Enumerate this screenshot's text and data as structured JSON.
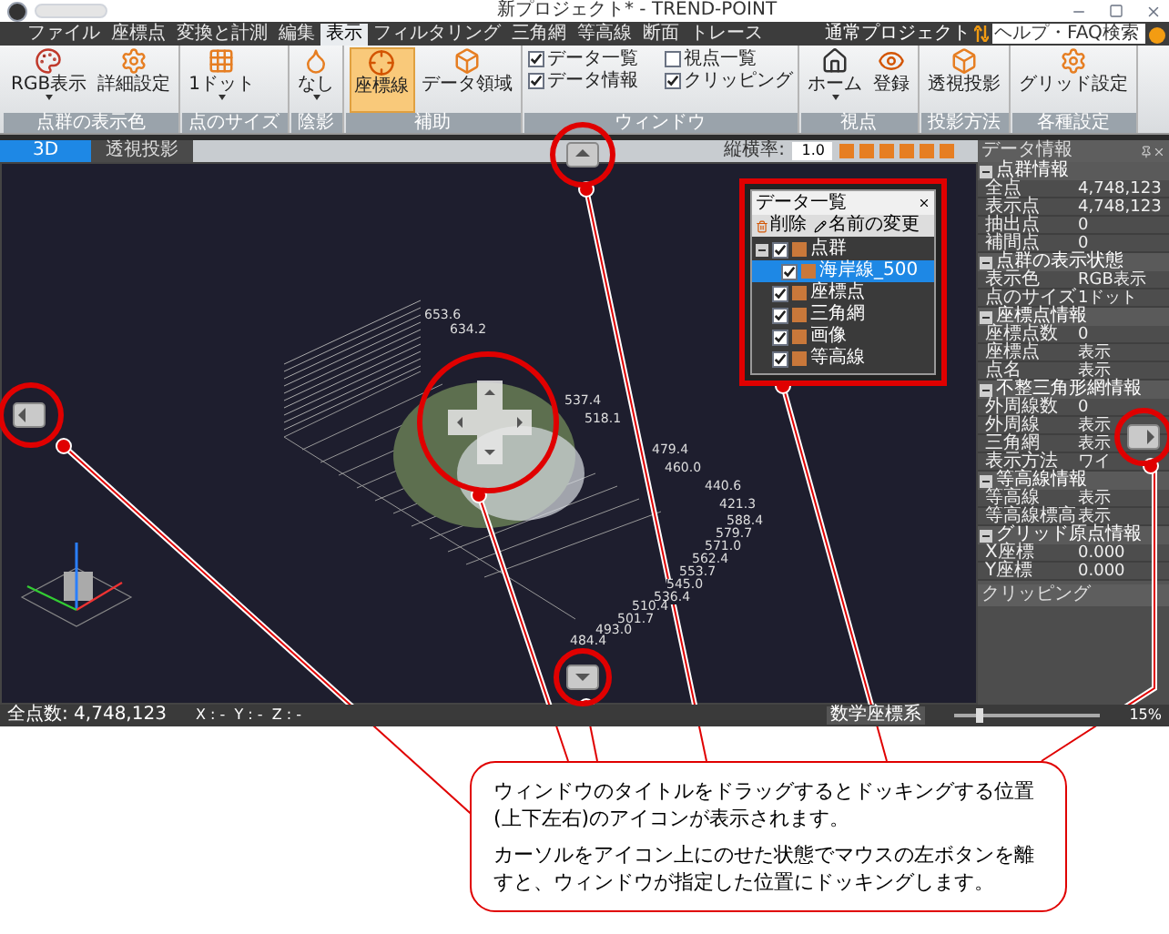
{
  "window": {
    "title": "新プロジェクト* - TREND-POINT"
  },
  "menu_tabs": [
    {
      "label": "ファイル",
      "selected": false
    },
    {
      "label": "座標点",
      "selected": false
    },
    {
      "label": "変換と計測",
      "selected": false
    },
    {
      "label": "編集",
      "selected": false
    },
    {
      "label": "表示",
      "selected": true
    },
    {
      "label": "フィルタリング",
      "selected": false
    },
    {
      "label": "三角網",
      "selected": false
    },
    {
      "label": "等高線",
      "selected": false
    },
    {
      "label": "断面",
      "selected": false
    },
    {
      "label": "トレース",
      "selected": false
    }
  ],
  "header_right": {
    "project_mode": "通常プロジェクト",
    "help_search": {
      "placeholder": "ヘルプ・FAQ検索"
    }
  },
  "ribbon_groups": [
    {
      "label": "点群の表示色",
      "items": [
        {
          "kind": "button",
          "label": "RGB表示",
          "dropdown": true,
          "selected": false
        },
        {
          "kind": "button",
          "label": "詳細設定",
          "dropdown": false,
          "selected": false
        }
      ]
    },
    {
      "label": "点のサイズ",
      "items": [
        {
          "kind": "button",
          "label": "1ドット",
          "dropdown": true,
          "selected": false
        }
      ]
    },
    {
      "label": "陰影",
      "items": [
        {
          "kind": "button",
          "label": "なし",
          "dropdown": true,
          "selected": false
        }
      ]
    },
    {
      "label": "補助",
      "items": [
        {
          "kind": "button",
          "label": "座標線",
          "dropdown": false,
          "selected": true
        },
        {
          "kind": "button",
          "label": "データ領域",
          "dropdown": false,
          "selected": false
        }
      ]
    },
    {
      "label": "ウィンドウ",
      "items": [
        {
          "kind": "checkbox",
          "label": "データ一覧",
          "checked": true
        },
        {
          "kind": "checkbox",
          "label": "視点一覧",
          "checked": false
        },
        {
          "kind": "checkbox",
          "label": "データ情報",
          "checked": true
        },
        {
          "kind": "checkbox",
          "label": "クリッピング",
          "checked": true
        }
      ]
    },
    {
      "label": "視点",
      "items": [
        {
          "kind": "button",
          "label": "ホーム",
          "dropdown": true,
          "selected": false
        },
        {
          "kind": "button",
          "label": "登録",
          "dropdown": false,
          "selected": false
        }
      ]
    },
    {
      "label": "投影方法",
      "items": [
        {
          "kind": "button",
          "label": "透視投影",
          "dropdown": false,
          "selected": false
        }
      ]
    },
    {
      "label": "各種設定",
      "items": [
        {
          "kind": "button",
          "label": "グリッド設定",
          "dropdown": false,
          "selected": false
        }
      ]
    }
  ],
  "view_tabs": [
    {
      "label": "3D",
      "selected": true
    },
    {
      "label": "透視投影",
      "selected": false
    }
  ],
  "view_toolbar": {
    "aspect_label": "縦横率:",
    "aspect_value": "1.0"
  },
  "canvas": {
    "axis_labels": [
      "653.6",
      "634.2",
      "537.4",
      "518.1",
      "479.4",
      "460.0",
      "440.6",
      "421.3",
      "588.4",
      "579.7",
      "571.0",
      "562.4",
      "553.7",
      "545.0",
      "536.4",
      "510.4",
      "501.7",
      "493.0",
      "484.4"
    ]
  },
  "data_list": {
    "title": "データ一覧",
    "toolbar": [
      "削除",
      "名前の変更"
    ],
    "tree": [
      {
        "label": "点群",
        "checked": true,
        "expanded": true,
        "selected": false,
        "children": [
          {
            "label": "海岸線_500",
            "checked": true,
            "selected": true
          }
        ]
      },
      {
        "label": "座標点",
        "checked": true,
        "selected": false
      },
      {
        "label": "三角網",
        "checked": true,
        "selected": false
      },
      {
        "label": "画像",
        "checked": true,
        "selected": false
      },
      {
        "label": "等高線",
        "checked": true,
        "selected": false
      }
    ]
  },
  "data_info": {
    "title": "データ情報",
    "sections": [
      {
        "title": "点群情報",
        "expanded": true,
        "rows": [
          {
            "name": "全点",
            "value": "4,748,123"
          },
          {
            "name": "表示点",
            "value": "4,748,123"
          },
          {
            "name": "抽出点",
            "value": "0"
          },
          {
            "name": "補間点",
            "value": "0"
          }
        ]
      },
      {
        "title": "点群の表示状態",
        "expanded": true,
        "rows": [
          {
            "name": "表示色",
            "value": "RGB表示"
          },
          {
            "name": "点のサイズ",
            "value": "1ドット"
          }
        ]
      },
      {
        "title": "座標点情報",
        "expanded": true,
        "rows": [
          {
            "name": "座標点数",
            "value": "0"
          },
          {
            "name": "座標点",
            "value": "表示"
          },
          {
            "name": "点名",
            "value": "表示"
          }
        ]
      },
      {
        "title": "不整三角形網情報",
        "expanded": true,
        "rows": [
          {
            "name": "外周線数",
            "value": "0"
          },
          {
            "name": "外周線",
            "value": "表示"
          },
          {
            "name": "三角網",
            "value": "表示"
          },
          {
            "name": "表示方法",
            "value": "ワイ"
          }
        ]
      },
      {
        "title": "等高線情報",
        "expanded": true,
        "rows": [
          {
            "name": "等高線",
            "value": "表示"
          },
          {
            "name": "等高線標高",
            "value": "表示"
          }
        ]
      },
      {
        "title": "グリッド原点情報",
        "expanded": true,
        "rows": [
          {
            "name": "X座標",
            "value": "0.000"
          },
          {
            "name": "Y座標",
            "value": "0.000"
          }
        ]
      }
    ]
  },
  "clipping": {
    "title": "クリッピング"
  },
  "status_bar": {
    "point_count": "全点数: 4,748,123",
    "coords": "X : -  Y : -  Z : -",
    "coord_system": "数学座標系",
    "zoom": "15%",
    "zoom_slider": {
      "level": 0.15
    }
  },
  "callout": {
    "paragraphs": [
      "ウィンドウのタイトルをドラッグするとドッキングする位置(上下左右)のアイコンが表示されます。",
      "カーソルをアイコン上にのせた状態でマウスの左ボタンを離すと、ウィンドウが指定した位置にドッキングします。"
    ]
  }
}
